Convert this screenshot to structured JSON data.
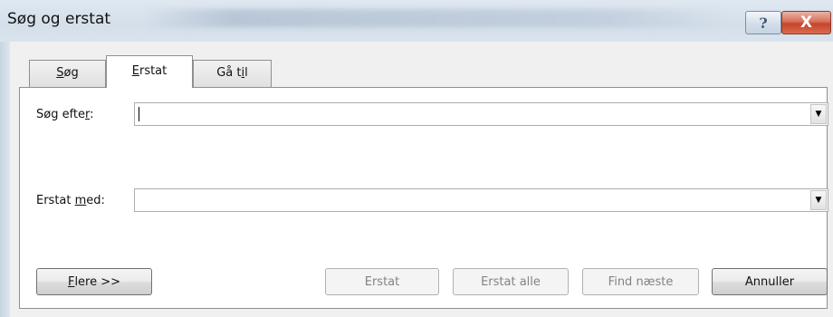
{
  "window": {
    "title": "Søg og erstat",
    "help_glyph": "?",
    "close_glyph": "X"
  },
  "tabs": [
    {
      "pre": "",
      "accel": "S",
      "post": "øg",
      "active": false
    },
    {
      "pre": "",
      "accel": "E",
      "post": "rstat",
      "active": true
    },
    {
      "pre": "Gå t",
      "accel": "i",
      "post": "l",
      "active": false
    }
  ],
  "find": {
    "label_pre": "Søg efte",
    "label_accel": "r",
    "label_post": ":",
    "value": ""
  },
  "replace": {
    "label_pre": "Erstat ",
    "label_accel": "m",
    "label_post": "ed:",
    "value": ""
  },
  "dropdown_glyph": "▼",
  "buttons": {
    "more": {
      "pre": "",
      "accel": "F",
      "post": "lere >>"
    },
    "replace": "Erstat",
    "replace_all": "Erstat alle",
    "find_next": "Find næste",
    "cancel": "Annuller"
  }
}
